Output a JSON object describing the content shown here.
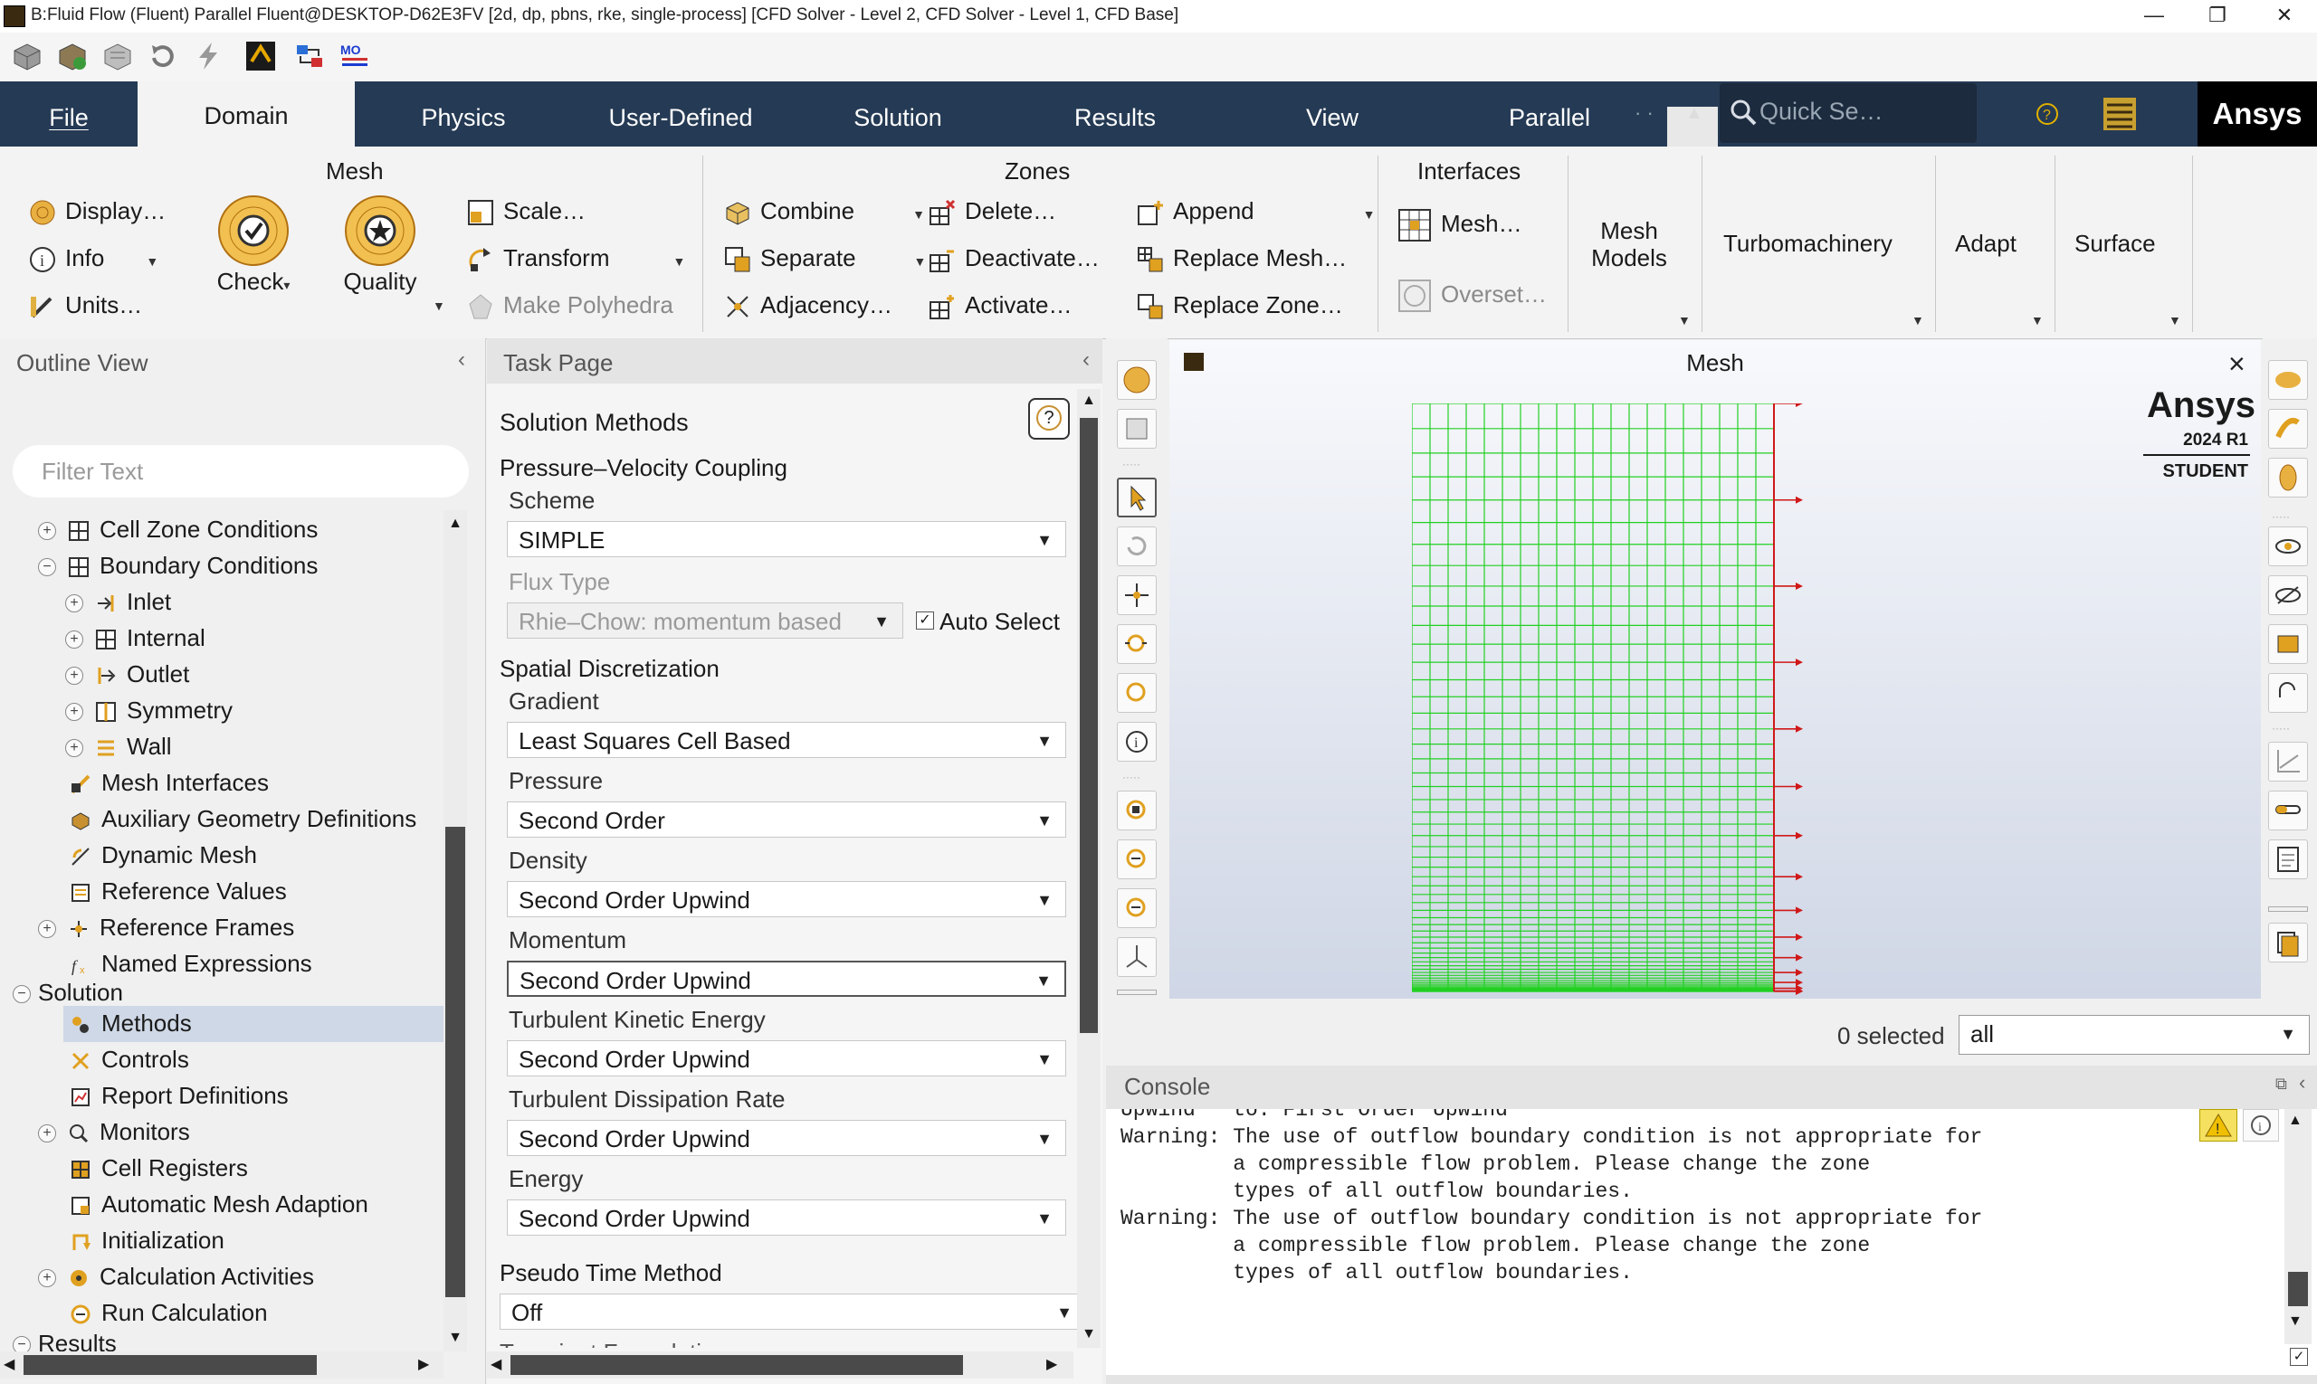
{
  "window": {
    "title": "B:Fluid Flow (Fluent) Parallel Fluent@DESKTOP-D62E3FV  [2d, dp, pbns, rke, single-process] [CFD Solver - Level 2, CFD Solver - Level 1, CFD Base]",
    "minimize": "—",
    "maximize": "❐",
    "close": "✕"
  },
  "tabs": [
    {
      "label": "File",
      "underline": "F"
    },
    {
      "label": "Domain"
    },
    {
      "label": "Physics"
    },
    {
      "label": "User-Defined"
    },
    {
      "label": "Solution"
    },
    {
      "label": "Results"
    },
    {
      "label": "View"
    },
    {
      "label": "Parallel"
    }
  ],
  "quick_search": {
    "placeholder": "Quick Se…"
  },
  "brand": "Ansys",
  "ribbon": {
    "mesh": {
      "title": "Mesh",
      "display": "Display…",
      "info": "Info",
      "units": "Units…",
      "check": "Check",
      "quality": "Quality",
      "scale": "Scale…",
      "transform": "Transform",
      "make_polyhedra": "Make Polyhedra"
    },
    "zones": {
      "title": "Zones",
      "combine": "Combine",
      "separate": "Separate",
      "adjacency": "Adjacency…",
      "delete": "Delete…",
      "deactivate": "Deactivate…",
      "activate": "Activate…",
      "append": "Append",
      "replace_mesh": "Replace Mesh…",
      "replace_zone": "Replace Zone…"
    },
    "interfaces": {
      "title": "Interfaces",
      "mesh": "Mesh…",
      "overset": "Overset…"
    },
    "mesh_models": "Mesh\nModels",
    "turbomachinery": "Turbomachinery",
    "adapt": "Adapt",
    "surface": "Surface"
  },
  "outline": {
    "title": "Outline View",
    "filter_placeholder": "Filter Text",
    "items": [
      {
        "label": "Cell Zone Conditions",
        "expander": "+"
      },
      {
        "label": "Boundary Conditions",
        "expander": "−"
      },
      {
        "label": "Inlet",
        "expander": "+"
      },
      {
        "label": "Internal",
        "expander": "+"
      },
      {
        "label": "Outlet",
        "expander": "+"
      },
      {
        "label": "Symmetry",
        "expander": "+"
      },
      {
        "label": "Wall",
        "expander": "+"
      },
      {
        "label": "Mesh Interfaces"
      },
      {
        "label": "Auxiliary Geometry Definitions"
      },
      {
        "label": "Dynamic Mesh"
      },
      {
        "label": "Reference Values"
      },
      {
        "label": "Reference Frames",
        "expander": "+"
      },
      {
        "label": "Named Expressions"
      },
      {
        "label": "Solution",
        "expander": "−"
      },
      {
        "label": "Methods"
      },
      {
        "label": "Controls"
      },
      {
        "label": "Report Definitions"
      },
      {
        "label": "Monitors",
        "expander": "+"
      },
      {
        "label": "Cell Registers"
      },
      {
        "label": "Automatic Mesh Adaption"
      },
      {
        "label": "Initialization"
      },
      {
        "label": "Calculation Activities",
        "expander": "+"
      },
      {
        "label": "Run Calculation"
      },
      {
        "label": "Results",
        "expander": "−"
      }
    ]
  },
  "task_page": {
    "title": "Task Page",
    "heading": "Solution Methods",
    "help": "?",
    "pv_coupling": "Pressure–Velocity Coupling",
    "scheme_label": "Scheme",
    "scheme": "SIMPLE",
    "flux_label": "Flux Type",
    "flux": "Rhie–Chow: momentum based",
    "auto_select": "Auto Select",
    "auto_select_checked": true,
    "spatial": "Spatial Discretization",
    "gradient_label": "Gradient",
    "gradient": "Least Squares Cell Based",
    "pressure_label": "Pressure",
    "pressure": "Second Order",
    "density_label": "Density",
    "density": "Second Order Upwind",
    "momentum_label": "Momentum",
    "momentum": "Second Order Upwind",
    "tke_label": "Turbulent Kinetic Energy",
    "tke": "Second Order Upwind",
    "tdr_label": "Turbulent Dissipation Rate",
    "tdr": "Second Order Upwind",
    "energy_label": "Energy",
    "energy": "Second Order Upwind",
    "pseudo_label": "Pseudo Time Method",
    "pseudo": "Off",
    "transient_partial": "Transient Formulation"
  },
  "graphics": {
    "title": "Mesh",
    "close": "×",
    "brand": "Ansys",
    "version": "2024 R1",
    "edition": "STUDENT",
    "selected": "0 selected",
    "filter": "all"
  },
  "console": {
    "title": "Console",
    "lines": [
      "Upwind   to: First Order Upwind",
      "Warning: The use of outflow boundary condition is not appropriate for",
      "         a compressible flow problem. Please change the zone",
      "         types of all outflow boundaries.",
      "",
      "Warning: The use of outflow boundary condition is not appropriate for",
      "         a compressible flow problem. Please change the zone",
      "         types of all outflow boundaries."
    ]
  },
  "colors": {
    "tabbar": "#253a54",
    "mesh_lines": "#22d022",
    "boundary": "#d01818"
  }
}
